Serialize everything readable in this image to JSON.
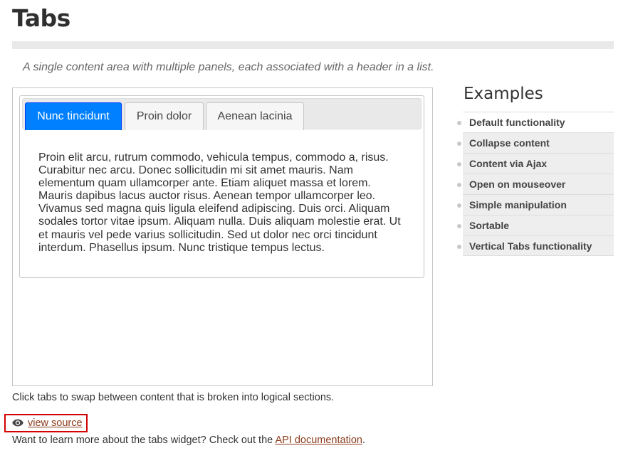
{
  "page": {
    "title": "Tabs",
    "subtitle": "A single content area with multiple panels, each associated with a header in a list."
  },
  "demo": {
    "tabs": [
      {
        "label": "Nunc tincidunt",
        "active": true
      },
      {
        "label": "Proin dolor",
        "active": false
      },
      {
        "label": "Aenean lacinia",
        "active": false
      }
    ],
    "panel_text": "Proin elit arcu, rutrum commodo, vehicula tempus, commodo a, risus. Curabitur nec arcu. Donec sollicitudin mi sit amet mauris. Nam elementum quam ullamcorper ante. Etiam aliquet massa et lorem. Mauris dapibus lacus auctor risus. Aenean tempor ullamcorper leo. Vivamus sed magna quis ligula eleifend adipiscing. Duis orci. Aliquam sodales tortor vitae ipsum. Aliquam nulla. Duis aliquam molestie erat. Ut et mauris vel pede varius sollicitudin. Sed ut dolor nec orci tincidunt interdum. Phasellus ipsum. Nunc tristique tempus lectus."
  },
  "examples": {
    "title": "Examples",
    "items": [
      "Default functionality",
      "Collapse content",
      "Content via Ajax",
      "Open on mouseover",
      "Simple manipulation",
      "Sortable",
      "Vertical Tabs functionality"
    ]
  },
  "footer": {
    "description": "Click tabs to swap between content that is broken into logical sections.",
    "view_source_label": "view source",
    "more_prefix": "Want to learn more about the tabs widget? Check out the ",
    "api_link_label": "API documentation",
    "more_suffix": "."
  },
  "colors": {
    "active_tab_bg": "#007fff",
    "link": "#8b3b1b",
    "highlight_border": "#d40000"
  },
  "icons": {
    "view_source": "eye-icon",
    "list_bullet": "bullet-dot"
  }
}
